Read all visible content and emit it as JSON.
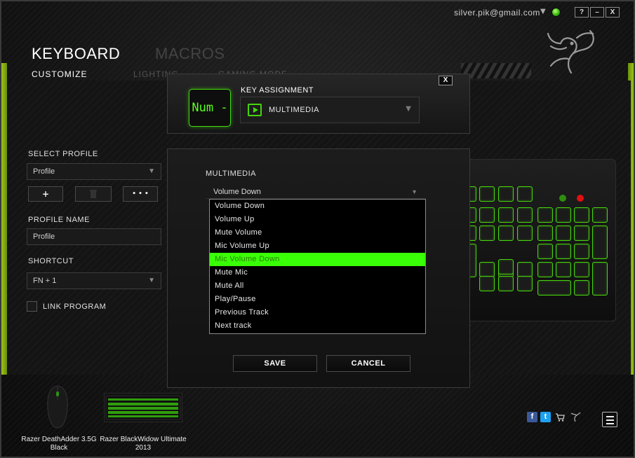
{
  "window": {
    "account_email": "silver.pik@gmail.com",
    "help_label": "?",
    "minimize_label": "–",
    "close_label": "X"
  },
  "nav": {
    "main_tabs": [
      "KEYBOARD",
      "MACROS"
    ],
    "sub_tabs": [
      "CUSTOMIZE",
      "LIGHTING",
      "GAMING MODE"
    ]
  },
  "left_panel": {
    "select_profile_label": "SELECT PROFILE",
    "profile_value": "Profile",
    "add_label": "+",
    "more_label": "• • •",
    "profile_name_label": "PROFILE NAME",
    "profile_name_value": "Profile",
    "shortcut_label": "SHORTCUT",
    "shortcut_value": "FN + 1",
    "link_program_label": "LINK PROGRAM"
  },
  "dialog": {
    "close_label": "X",
    "key_name": "Num -",
    "key_assignment_label": "KEY ASSIGNMENT",
    "key_assignment_value": "MULTIMEDIA",
    "multimedia_label": "MULTIMEDIA",
    "multimedia_selected": "Volume Down",
    "multimedia_options": [
      "Volume Down",
      "Volume Up",
      "Mute Volume",
      "Mic Volume Up",
      "Mic Volume Down",
      "Mute Mic",
      "Mute All",
      "Play/Pause",
      "Previous Track",
      "Next track"
    ],
    "highlighted_option": "Mic Volume Down",
    "save_label": "SAVE",
    "cancel_label": "CANCEL"
  },
  "devices": [
    {
      "name_line1": "Razer DeathAdder 3.5G",
      "name_line2": "Black"
    },
    {
      "name_line1": "Razer BlackWidow Ultimate",
      "name_line2": "2013"
    }
  ],
  "social": {
    "facebook": "f",
    "twitter": "t"
  },
  "colors": {
    "accent_green": "#47d60c",
    "highlight_green": "#39ff07",
    "frame_lime": "#9ac516",
    "background": "#141414"
  },
  "icons": [
    "razer-logo-icon",
    "shopping-cart-icon",
    "razer-mini-icon",
    "hamburger-menu-icon",
    "multimedia-play-icon",
    "trash-icon",
    "status-online-icon"
  ]
}
